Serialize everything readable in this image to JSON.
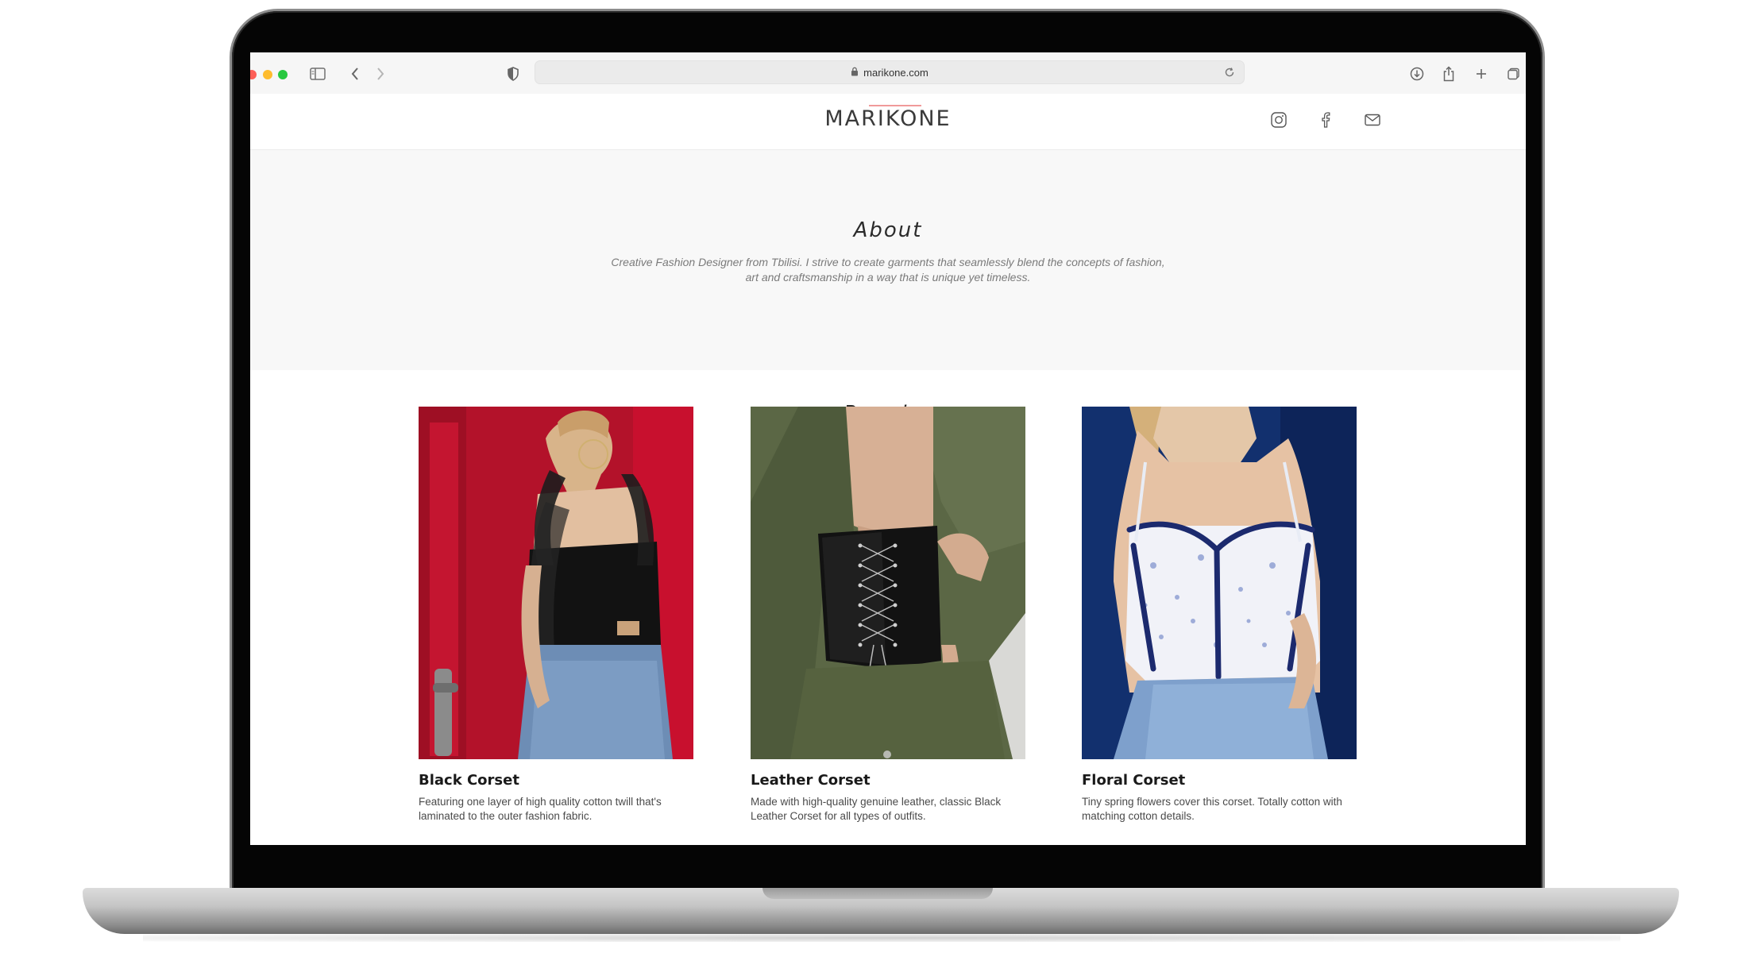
{
  "browser": {
    "url": "marikone.com"
  },
  "site": {
    "logo": "MARIKONE",
    "social": [
      {
        "icon": "instagram-icon"
      },
      {
        "icon": "facebook-icon"
      },
      {
        "icon": "mail-icon"
      }
    ]
  },
  "about": {
    "title": "About",
    "text": "Creative Fashion Designer from Tbilisi. I strive to create garments that seamlessly blend the concepts of fashion, art and craftsmanship in a way that is unique yet timeless."
  },
  "popular": {
    "title": "Popular",
    "items": [
      {
        "title": "Black Corset",
        "desc": "Featuring one layer of high quality cotton twill that's laminated to the outer fashion fabric."
      },
      {
        "title": "Leather Corset",
        "desc": "Made with high-quality genuine leather, classic Black Leather Corset for all types of outfits."
      },
      {
        "title": "Floral Corset",
        "desc": "Tiny spring flowers cover this corset. Totally cotton with matching cotton details."
      }
    ]
  },
  "colors": {
    "accent": "#f09a9a",
    "about_bg": "#f8f8f8",
    "red_door": "#c8102e",
    "olive": "#5a6645",
    "navy": "#0f2a6b"
  }
}
